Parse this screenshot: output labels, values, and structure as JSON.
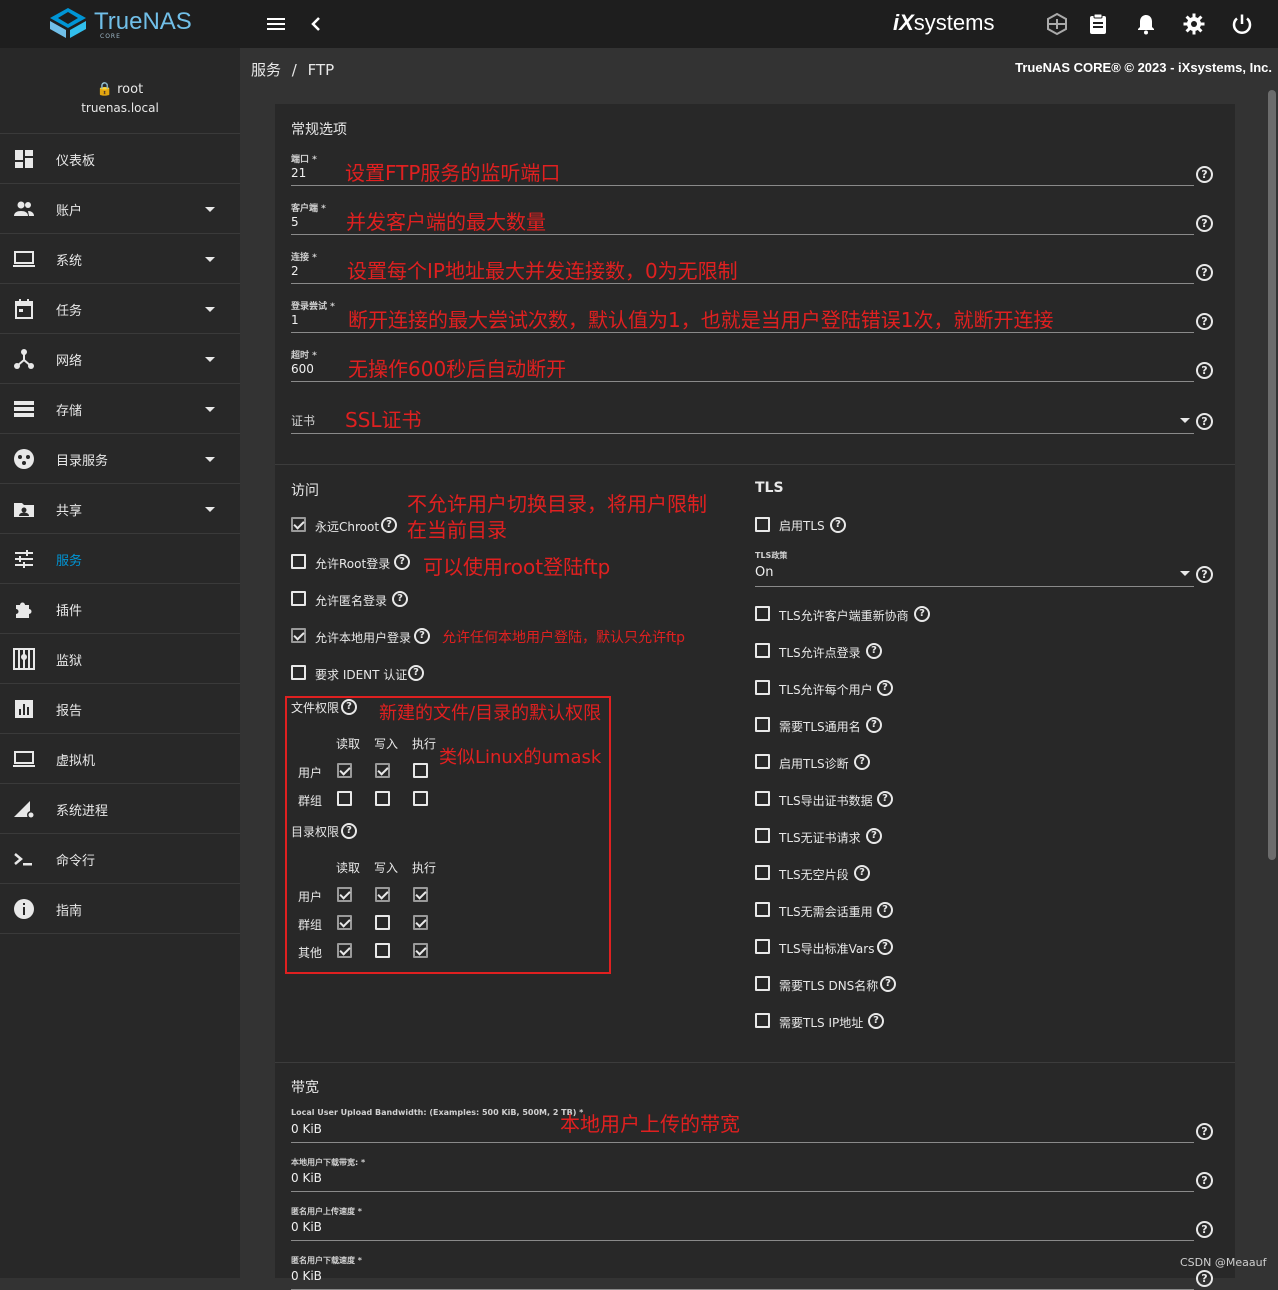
{
  "topbar": {
    "brand": "TrueNAS",
    "brand_sub": "CORE",
    "vendor_ix": "iX",
    "vendor_sys": "systems"
  },
  "user": {
    "name": "root",
    "host": "truenas.local"
  },
  "sidebar": {
    "items": [
      {
        "label": "仪表板",
        "icon": "dashboard-icon",
        "caret": false
      },
      {
        "label": "账户",
        "icon": "accounts-icon",
        "caret": true
      },
      {
        "label": "系统",
        "icon": "system-icon",
        "caret": true
      },
      {
        "label": "任务",
        "icon": "tasks-icon",
        "caret": true
      },
      {
        "label": "网络",
        "icon": "network-icon",
        "caret": true
      },
      {
        "label": "存储",
        "icon": "storage-icon",
        "caret": true
      },
      {
        "label": "目录服务",
        "icon": "directory-icon",
        "caret": true
      },
      {
        "label": "共享",
        "icon": "shares-icon",
        "caret": true
      },
      {
        "label": "服务",
        "icon": "services-icon",
        "caret": false,
        "active": true
      },
      {
        "label": "插件",
        "icon": "plugins-icon",
        "caret": false
      },
      {
        "label": "监狱",
        "icon": "jails-icon",
        "caret": false
      },
      {
        "label": "报告",
        "icon": "reports-icon",
        "caret": false
      },
      {
        "label": "虚拟机",
        "icon": "vm-icon",
        "caret": false
      },
      {
        "label": "系统进程",
        "icon": "processes-icon",
        "caret": false
      },
      {
        "label": "命令行",
        "icon": "shell-icon",
        "caret": false
      },
      {
        "label": "指南",
        "icon": "guide-icon",
        "caret": false
      }
    ]
  },
  "breadcrumb": {
    "parent": "服务",
    "sep": "/",
    "current": "FTP"
  },
  "copyright": "TrueNAS CORE® © 2023 - iXsystems, Inc.",
  "general": {
    "title": "常规选项",
    "fields": [
      {
        "label": "端口 *",
        "value": "21",
        "annot": "设置FTP服务的监听端口"
      },
      {
        "label": "客户端 *",
        "value": "5",
        "annot": "并发客户端的最大数量"
      },
      {
        "label": "连接 *",
        "value": "2",
        "annot": "设置每个IP地址最大并发连接数，0为无限制"
      },
      {
        "label": "登录尝试 *",
        "value": "1",
        "annot": "断开连接的最大尝试次数，默认值为1，也就是当用户登陆错误1次，就断开连接"
      },
      {
        "label": "超时 *",
        "value": "600",
        "annot": "无操作600秒后自动断开"
      }
    ],
    "cert_label": "证书",
    "cert_annot": "SSL证书"
  },
  "access": {
    "title": "访问",
    "options": [
      {
        "label": "永远Chroot",
        "checked": true
      },
      {
        "label": "允许Root登录",
        "checked": false
      },
      {
        "label": "允许匿名登录",
        "checked": false
      },
      {
        "label": "允许本地用户登录",
        "checked": true
      },
      {
        "label": "要求 IDENT 认证",
        "checked": false
      }
    ],
    "annot_chroot_1": "不允许用户切换目录，将用户限制",
    "annot_chroot_2": "在当前目录",
    "annot_root": "可以使用root登陆ftp",
    "annot_local": "允许任何本地用户登陆，默认只允许ftp",
    "file_perm_title": "文件权限",
    "file_perm_annot": "新建的文件/目录的默认权限",
    "umask_annot": "类似Linux的umask",
    "dir_perm_title": "目录权限",
    "perm_cols": [
      "读取",
      "写入",
      "执行"
    ],
    "file_rows": [
      {
        "label": "用户",
        "values": [
          true,
          true,
          false
        ]
      },
      {
        "label": "群组",
        "values": [
          false,
          false,
          false
        ]
      }
    ],
    "dir_rows": [
      {
        "label": "用户",
        "values": [
          true,
          true,
          true
        ]
      },
      {
        "label": "群组",
        "values": [
          true,
          false,
          true
        ]
      },
      {
        "label": "其他",
        "values": [
          true,
          false,
          true
        ]
      }
    ]
  },
  "tls": {
    "title": "TLS",
    "enable_label": "启用TLS",
    "policy_label": "TLS政策",
    "policy_value": "On",
    "options": [
      "TLS允许客户端重新协商",
      "TLS允许点登录",
      "TLS允许每个用户",
      "需要TLS通用名",
      "启用TLS诊断",
      "TLS导出证书数据",
      "TLS无证书请求",
      "TLS无空片段",
      "TLS无需会话重用",
      "TLS导出标准Vars",
      "需要TLS DNS名称",
      "需要TLS IP地址"
    ]
  },
  "bandwidth": {
    "title": "带宽",
    "fields": [
      {
        "label": "Local User Upload Bandwidth: (Examples: 500 KiB, 500M, 2 TB) *",
        "value": "0 KiB"
      },
      {
        "label": "本地用户下载带宽: *",
        "value": "0 KiB"
      },
      {
        "label": "匿名用户上传速度 *",
        "value": "0 KiB"
      },
      {
        "label": "匿名用户下载速度 *",
        "value": "0 KiB"
      }
    ],
    "upload_annot": "本地用户上传的带宽"
  },
  "watermark": "CSDN @Meaauf",
  "colors": {
    "accent": "#0095d5",
    "annotation": "#e02020",
    "sidebar": "#282828",
    "topbar": "#1e1e1e"
  }
}
